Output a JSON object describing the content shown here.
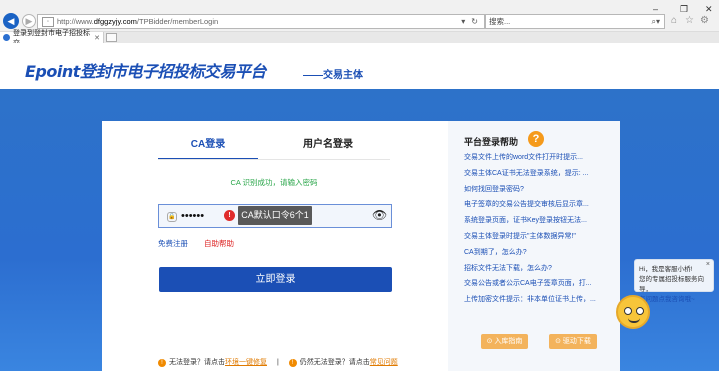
{
  "browser": {
    "url_prefix": "http://www.",
    "url_host": "dfggzyjy.com",
    "url_path": "/TPBidder/memberLogin",
    "search_placeholder": "搜索...",
    "tab_title": "登录到登封市电子招投标交...",
    "win_min": "–",
    "win_max": "❐",
    "win_close": "✕"
  },
  "header": {
    "logo": "Epoint登封市电子招投标交易平台",
    "subtitle": "——交易主体"
  },
  "login": {
    "tab_ca": "CA登录",
    "tab_user": "用户名登录",
    "success_msg": "CA 识别成功，请输入密码",
    "password_mask": "••••••",
    "tooltip": "CA默认口令6个1",
    "link_register": "免费注册",
    "link_help": "自助帮助",
    "submit": "立即登录",
    "bottom_text1": "无法登录？请点击",
    "bottom_link1": "环境一键修复",
    "bottom_sep": "|",
    "bottom_text2": "仍然无法登录？请点击",
    "bottom_link2": "常见问题"
  },
  "help": {
    "title": "平台登录帮助",
    "items": [
      "交易文件上传的word文件打开时提示...",
      "交易主体CA证书无法登录系统，提示: ...",
      "如何找回登录密码?",
      "电子签章的交易公告提交审核后显示章...",
      "系统登录页面，证书Key登录按钮无法...",
      "交易主体登录时提示\"主体数据异常!\"",
      "CA到期了，怎么办?",
      "招标文件无法下载，怎么办?",
      "交易公告或者公示CA电子签章页面，打...",
      "上传加密文件提示：非本单位证书上传，..."
    ],
    "btn1": "入库指南",
    "btn2": "驱动下载"
  },
  "chat": {
    "line1": "Hi，我是客服小桥!",
    "line2": "您的专属招投标服务向导，",
    "line3": "有问题点我咨询哦~",
    "close": "×"
  },
  "colors": {
    "brand": "#1b4fb5",
    "banner": "#2d72c9",
    "success": "#2aa64a",
    "error": "#e02c2c",
    "accent": "#f59a1b"
  }
}
